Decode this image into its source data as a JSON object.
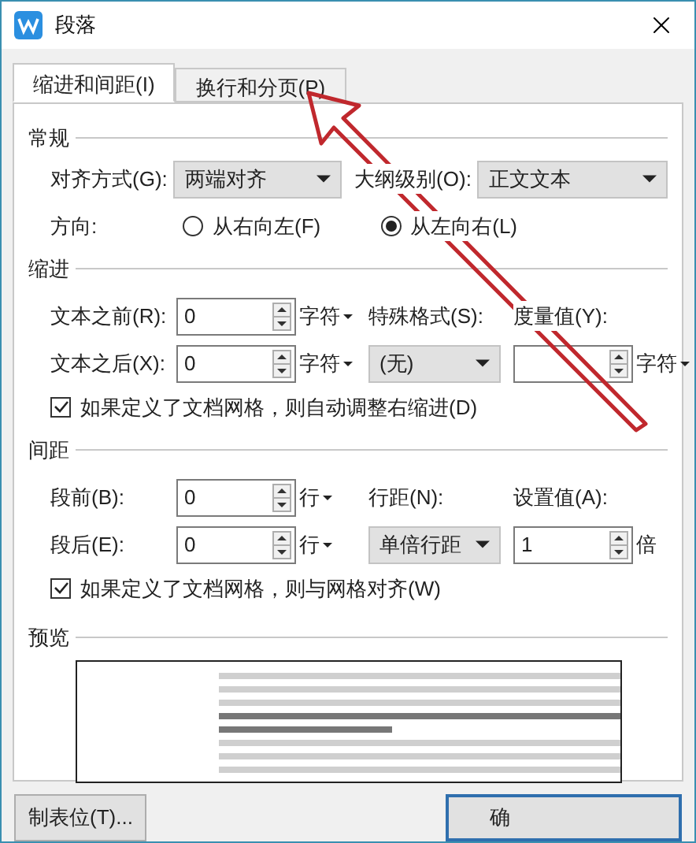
{
  "window": {
    "title": "段落"
  },
  "tabs": [
    {
      "label": "缩进和间距(I)",
      "selected": true
    },
    {
      "label": "换行和分页(P)",
      "selected": false
    }
  ],
  "general": {
    "heading": "常规",
    "alignment": {
      "label": "对齐方式(G):",
      "value": "两端对齐"
    },
    "outline_level": {
      "label": "大纲级别(O):",
      "value": "正文文本"
    },
    "direction": {
      "label": "方向:",
      "options": [
        {
          "label": "从右向左(F)",
          "selected": false
        },
        {
          "label": "从左向右(L)",
          "selected": true
        }
      ]
    }
  },
  "indent": {
    "heading": "缩进",
    "before": {
      "label": "文本之前(R):",
      "value": "0",
      "unit": "字符",
      "dropdown": true
    },
    "after": {
      "label": "文本之后(X):",
      "value": "0",
      "unit": "字符",
      "dropdown": true
    },
    "special_format": {
      "label": "特殊格式(S):",
      "value": "(无)"
    },
    "measure": {
      "label": "度量值(Y):",
      "unit": "字符",
      "dropdown": true
    },
    "auto_adjust": {
      "label": "如果定义了文档网格，则自动调整右缩进(D)",
      "checked": true
    }
  },
  "spacing": {
    "heading": "间距",
    "before": {
      "label": "段前(B):",
      "value": "0",
      "unit": "行",
      "dropdown": true
    },
    "after": {
      "label": "段后(E):",
      "value": "0",
      "unit": "行",
      "dropdown": true
    },
    "line_spacing": {
      "label": "行距(N):",
      "value": "单倍行距"
    },
    "setting": {
      "label": "设置值(A):",
      "value": "1",
      "unit": "倍",
      "dropdown": false
    },
    "snap_grid": {
      "label": "如果定义了文档网格，则与网格对齐(W)",
      "checked": true
    }
  },
  "preview": {
    "heading": "预览"
  },
  "buttons": [
    {
      "label": "制表位(T)...",
      "default": false
    },
    {
      "label": "确",
      "default": true
    }
  ]
}
